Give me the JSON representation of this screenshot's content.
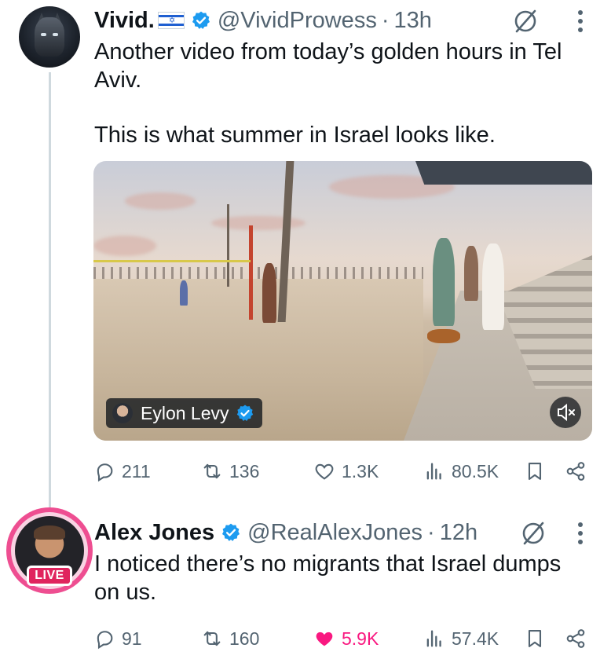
{
  "tweets": [
    {
      "name": "Vivid.",
      "handle": "@VividProwess",
      "separator": "·",
      "time": "13h",
      "text_line1": "Another video from today’s golden hours in Tel",
      "text_line2": "Aviv.",
      "text_line3": "This is what summer in Israel looks like.",
      "media": {
        "credit_name": "Eylon Levy"
      },
      "actions": {
        "replies": "211",
        "reposts": "136",
        "likes": "1.3K",
        "views": "80.5K"
      }
    },
    {
      "name": "Alex Jones",
      "handle": "@RealAlexJones",
      "separator": "·",
      "time": "12h",
      "live_badge": "LIVE",
      "text_line1": "I noticed there’s no migrants that Israel dumps",
      "text_line2": "on us.",
      "actions": {
        "replies": "91",
        "reposts": "160",
        "likes": "5.9K",
        "views": "57.4K",
        "liked": true
      }
    }
  ],
  "colors": {
    "verified": "#1d9bf0",
    "like_active": "#f91880",
    "muted_text": "#536471",
    "live_ring": "#ee4e91"
  },
  "icons": [
    "reply-icon",
    "repost-icon",
    "like-icon",
    "views-icon",
    "bookmark-icon",
    "share-icon",
    "grok-icon",
    "more-icon",
    "mute-icon",
    "verified-badge-icon"
  ]
}
